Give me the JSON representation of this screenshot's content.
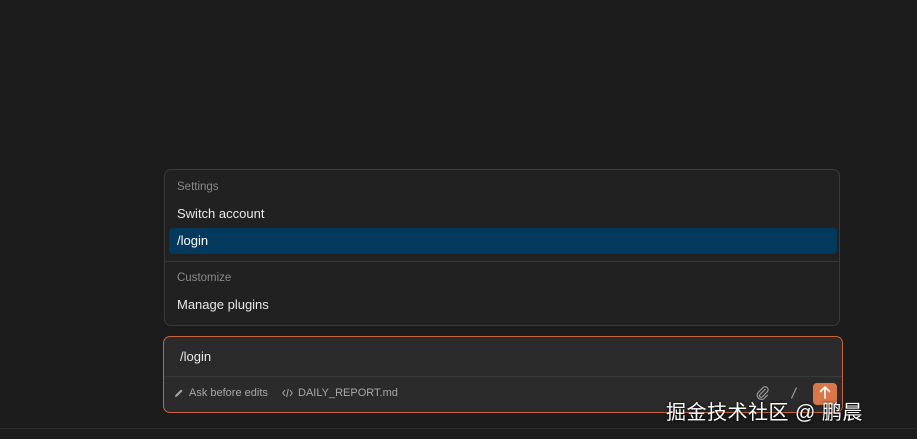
{
  "menu": {
    "sections": [
      {
        "label": "Settings",
        "items": [
          {
            "label": "Switch account",
            "selected": false
          },
          {
            "label": "/login",
            "selected": true
          }
        ]
      },
      {
        "label": "Customize",
        "items": [
          {
            "label": "Manage plugins",
            "selected": false
          }
        ]
      }
    ]
  },
  "input": {
    "value": "/login"
  },
  "toolbar": {
    "edit_mode_label": "Ask before edits",
    "file_label": "DAILY_REPORT.md",
    "icons": {
      "edit_mode": "pencil-icon",
      "file": "code-icon",
      "attach": "paperclip-icon",
      "slash": "slash-icon",
      "send": "arrow-up-icon"
    }
  },
  "watermark": {
    "text": "掘金技术社区 @ 鹏晨"
  },
  "colors": {
    "background": "#1c1c1c",
    "menu_background": "#212121",
    "selected_item": "#04395e",
    "input_border": "#c8653a",
    "send_button": "#d9774a"
  }
}
